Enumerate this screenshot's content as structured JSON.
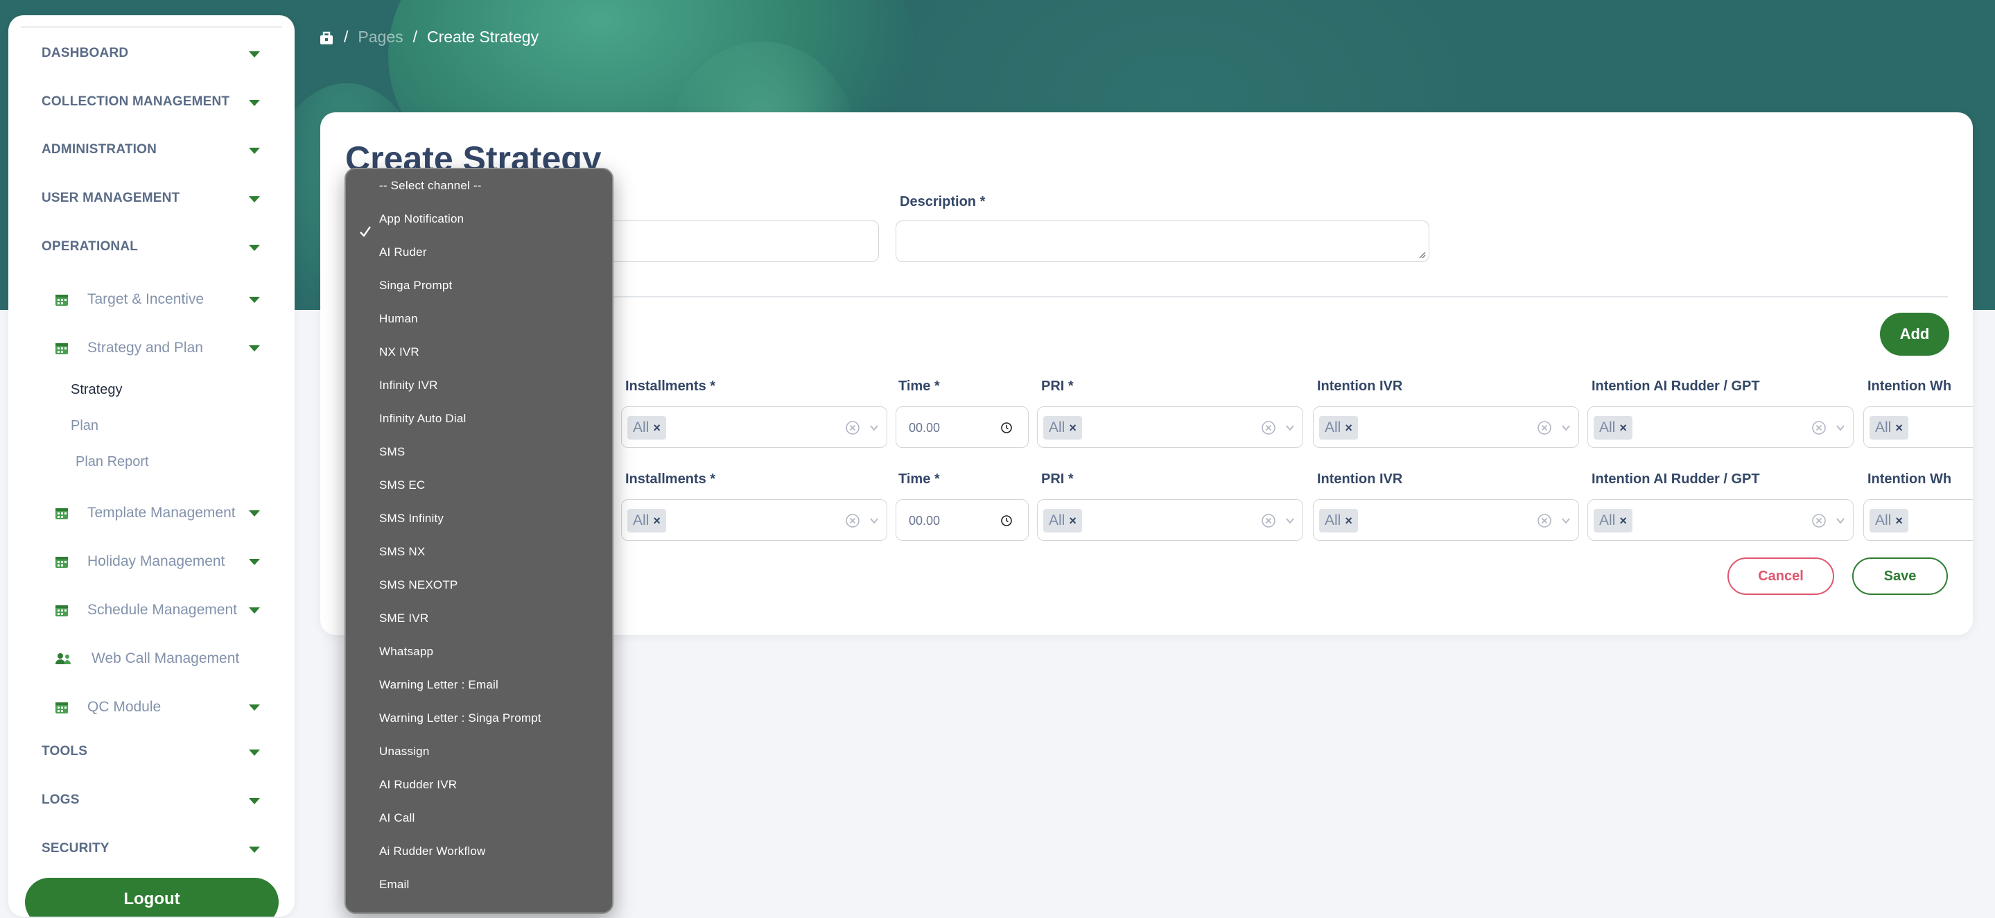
{
  "breadcrumb": {
    "pages": "Pages",
    "current": "Create Strategy",
    "separator": "/"
  },
  "sidebar": {
    "sections": [
      {
        "label": "DASHBOARD"
      },
      {
        "label": "COLLECTION MANAGEMENT"
      },
      {
        "label": "ADMINISTRATION"
      },
      {
        "label": "USER MANAGEMENT"
      },
      {
        "label": "OPERATIONAL"
      }
    ],
    "operational_items": [
      {
        "label": "Target & Incentive",
        "icon": "calendar-icon"
      },
      {
        "label": "Strategy and Plan",
        "icon": "calendar-icon"
      }
    ],
    "strategy_children": [
      {
        "label": "Strategy"
      },
      {
        "label": "Plan"
      },
      {
        "label": "Plan Report"
      }
    ],
    "more_items": [
      {
        "label": "Template Management",
        "icon": "calendar-icon"
      },
      {
        "label": "Holiday Management",
        "icon": "calendar-icon"
      },
      {
        "label": "Schedule Management",
        "icon": "calendar-icon"
      },
      {
        "label": "Web Call Management",
        "icon": "users-icon"
      },
      {
        "label": "QC Module",
        "icon": "calendar-icon"
      }
    ],
    "bottom_sections": [
      {
        "label": "TOOLS"
      },
      {
        "label": "LOGS"
      },
      {
        "label": "SECURITY"
      }
    ],
    "logout": "Logout"
  },
  "form": {
    "title": "Create Strategy",
    "description_label": "Description *",
    "add": "Add",
    "cancel": "Cancel",
    "save": "Save",
    "rows": [
      {
        "installments_label": "Installments *",
        "installments_value": "All",
        "time_label": "Time *",
        "time_value": "00.00",
        "pri_label": "PRI *",
        "pri_value": "All",
        "intention_ivr_label": "Intention IVR",
        "intention_ivr_value": "All",
        "intention_ai_label": "Intention AI Rudder / GPT",
        "intention_ai_value": "All",
        "intention_wh_label": "Intention Wh",
        "intention_wh_value": "All"
      },
      {
        "installments_label": "Installments *",
        "installments_value": "All",
        "time_label": "Time *",
        "time_value": "00.00",
        "pri_label": "PRI *",
        "pri_value": "All",
        "intention_ivr_label": "Intention IVR",
        "intention_ivr_value": "All",
        "intention_ai_label": "Intention AI Rudder / GPT",
        "intention_ai_value": "All",
        "intention_wh_label": "Intention Wh",
        "intention_wh_value": "All"
      }
    ]
  },
  "channel_dropdown": {
    "selected": "App Notification",
    "options": [
      "-- Select channel --",
      "App Notification",
      "AI Ruder",
      "Singa Prompt",
      "Human",
      "NX IVR",
      "Infinity IVR",
      "Infinity Auto Dial",
      "SMS",
      "SMS EC",
      "SMS Infinity",
      "SMS NX",
      "SMS NEXOTP",
      "SME IVR",
      "Whatsapp",
      "Warning Letter : Email",
      "Warning Letter : Singa Prompt",
      "Unassign",
      "AI Rudder IVR",
      "AI Call",
      "Ai Rudder Workflow",
      "Email"
    ]
  },
  "colors": {
    "brand_green": "#2e7d32",
    "banner": "#2b6a68",
    "cancel_red": "#e0566f",
    "dropdown_bg": "#5f5f5f"
  }
}
